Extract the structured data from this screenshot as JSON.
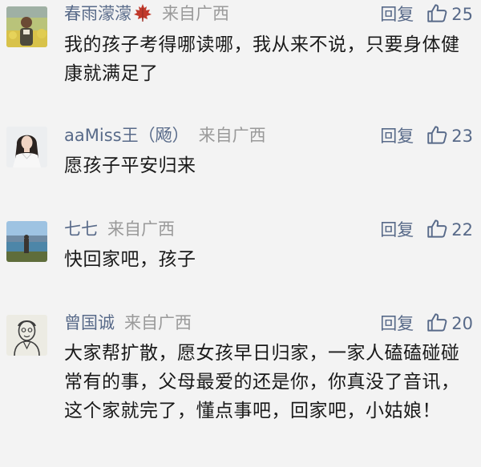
{
  "comments": [
    {
      "nickname": "春雨濛濛",
      "location": "来自广西",
      "content": "我的孩子考得哪读哪，我从来不说，只要身体健康就满足了",
      "reply_label": "回复",
      "likes": "25",
      "avatar_icon": "avatar-person-outdoor",
      "badge_icon": "maple-leaf-icon"
    },
    {
      "nickname": "aaMiss王（飏）",
      "location": "来自广西",
      "content": "愿孩子平安归来",
      "reply_label": "回复",
      "likes": "23",
      "avatar_icon": "avatar-woman"
    },
    {
      "nickname": "七七",
      "location": "来自广西",
      "content": "快回家吧，孩子",
      "reply_label": "回复",
      "likes": "22",
      "avatar_icon": "avatar-lake-landscape"
    },
    {
      "nickname": "曾国诚",
      "location": "来自广西",
      "content": "大家帮扩散，愿女孩早日归家，一家人磕磕碰碰常有的事，父母最爱的还是你，你真没了音讯，这个家就完了，懂点事吧，回家吧，小姑娘！",
      "reply_label": "回复",
      "likes": "20",
      "avatar_icon": "avatar-sketch-portrait"
    }
  ],
  "colors": {
    "background": "#f3f3f3",
    "nickname": "#586a89",
    "location": "#9a9a9a",
    "content": "#1a1a1a",
    "action": "#586a89"
  }
}
